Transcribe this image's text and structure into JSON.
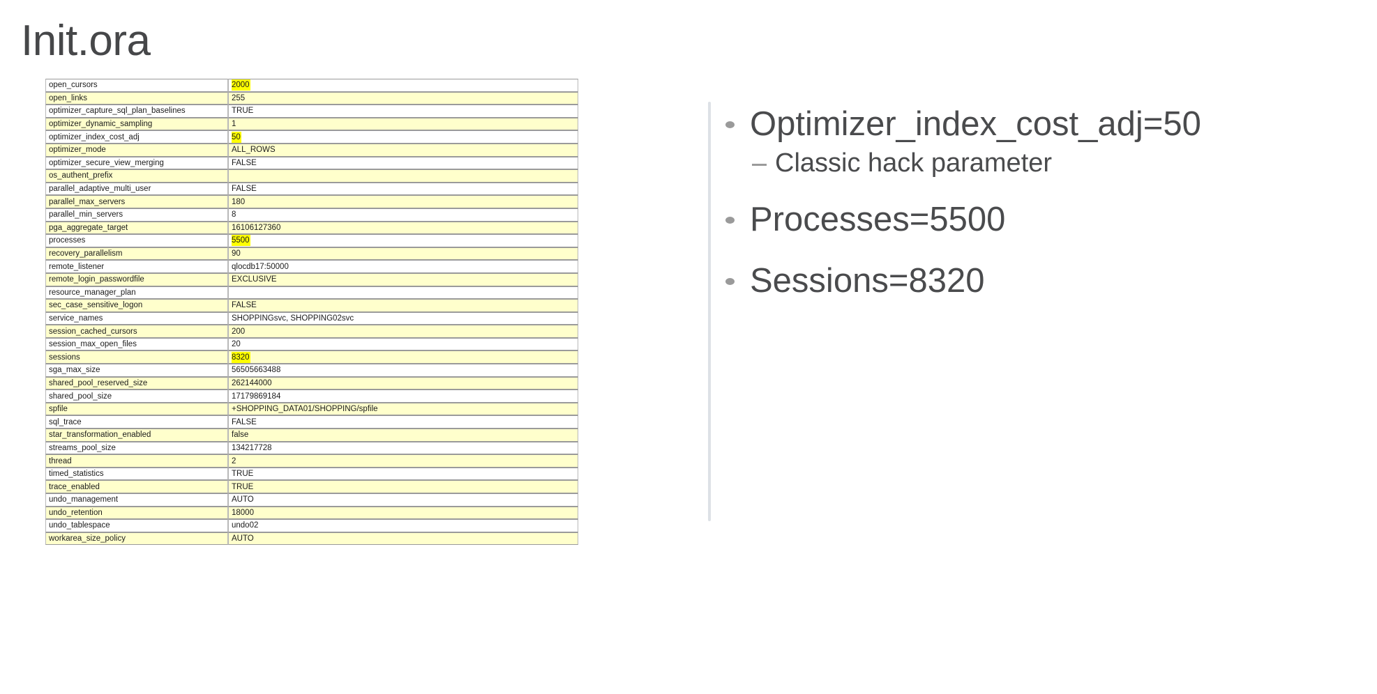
{
  "slide": {
    "title": "Init.ora",
    "title_color": "#464749",
    "background": "#ffffff"
  },
  "colors": {
    "band_row": "#ffffcc",
    "highlight": "#ffff00",
    "divider": "#dde1e6",
    "text": "#1b1b1b",
    "bullet_text": "#4a4b4d"
  },
  "param_table": {
    "rows": [
      {
        "name": "open_cursors",
        "value": "2000",
        "highlight": true,
        "band": false
      },
      {
        "name": "open_links",
        "value": "255",
        "highlight": false,
        "band": true
      },
      {
        "name": "optimizer_capture_sql_plan_baselines",
        "value": "TRUE",
        "highlight": false,
        "band": false
      },
      {
        "name": "optimizer_dynamic_sampling",
        "value": "1",
        "highlight": false,
        "band": true
      },
      {
        "name": "optimizer_index_cost_adj",
        "value": "50",
        "highlight": true,
        "band": false
      },
      {
        "name": "optimizer_mode",
        "value": "ALL_ROWS",
        "highlight": false,
        "band": true
      },
      {
        "name": "optimizer_secure_view_merging",
        "value": "FALSE",
        "highlight": false,
        "band": false
      },
      {
        "name": "os_authent_prefix",
        "value": "",
        "highlight": false,
        "band": true
      },
      {
        "name": "parallel_adaptive_multi_user",
        "value": "FALSE",
        "highlight": false,
        "band": false
      },
      {
        "name": "parallel_max_servers",
        "value": "180",
        "highlight": false,
        "band": true
      },
      {
        "name": "parallel_min_servers",
        "value": "8",
        "highlight": false,
        "band": false
      },
      {
        "name": "pga_aggregate_target",
        "value": "16106127360",
        "highlight": false,
        "band": true
      },
      {
        "name": "processes",
        "value": "5500",
        "highlight": true,
        "band": false
      },
      {
        "name": "recovery_parallelism",
        "value": "90",
        "highlight": false,
        "band": true
      },
      {
        "name": "remote_listener",
        "value": "qlocdb17:50000",
        "highlight": false,
        "band": false
      },
      {
        "name": "remote_login_passwordfile",
        "value": "EXCLUSIVE",
        "highlight": false,
        "band": true
      },
      {
        "name": "resource_manager_plan",
        "value": "",
        "highlight": false,
        "band": false
      },
      {
        "name": "sec_case_sensitive_logon",
        "value": "FALSE",
        "highlight": false,
        "band": true
      },
      {
        "name": "service_names",
        "value": "SHOPPINGsvc, SHOPPING02svc",
        "highlight": false,
        "band": false
      },
      {
        "name": "session_cached_cursors",
        "value": "200",
        "highlight": false,
        "band": true
      },
      {
        "name": "session_max_open_files",
        "value": "20",
        "highlight": false,
        "band": false
      },
      {
        "name": "sessions",
        "value": "8320",
        "highlight": true,
        "band": true
      },
      {
        "name": "sga_max_size",
        "value": "56505663488",
        "highlight": false,
        "band": false
      },
      {
        "name": "shared_pool_reserved_size",
        "value": "262144000",
        "highlight": false,
        "band": true
      },
      {
        "name": "shared_pool_size",
        "value": "17179869184",
        "highlight": false,
        "band": false
      },
      {
        "name": "spfile",
        "value": "+SHOPPING_DATA01/SHOPPING/spfile",
        "highlight": false,
        "band": true
      },
      {
        "name": "sql_trace",
        "value": "FALSE",
        "highlight": false,
        "band": false
      },
      {
        "name": "star_transformation_enabled",
        "value": "false",
        "highlight": false,
        "band": true
      },
      {
        "name": "streams_pool_size",
        "value": "134217728",
        "highlight": false,
        "band": false
      },
      {
        "name": "thread",
        "value": "2",
        "highlight": false,
        "band": true
      },
      {
        "name": "timed_statistics",
        "value": "TRUE",
        "highlight": false,
        "band": false
      },
      {
        "name": "trace_enabled",
        "value": "TRUE",
        "highlight": false,
        "band": true
      },
      {
        "name": "undo_management",
        "value": "AUTO",
        "highlight": false,
        "band": false
      },
      {
        "name": "undo_retention",
        "value": "18000",
        "highlight": false,
        "band": true
      },
      {
        "name": "undo_tablespace",
        "value": "undo02",
        "highlight": false,
        "band": false
      },
      {
        "name": "workarea_size_policy",
        "value": "AUTO",
        "highlight": false,
        "band": true
      }
    ]
  },
  "bullets": [
    {
      "level": 1,
      "text": "Optimizer_index_cost_adj=50",
      "sub": [
        {
          "level": 2,
          "text": "Classic hack parameter"
        }
      ]
    },
    {
      "level": 1,
      "text": "Processes=5500",
      "sub": []
    },
    {
      "level": 1,
      "text": "Sessions=8320",
      "sub": []
    }
  ]
}
